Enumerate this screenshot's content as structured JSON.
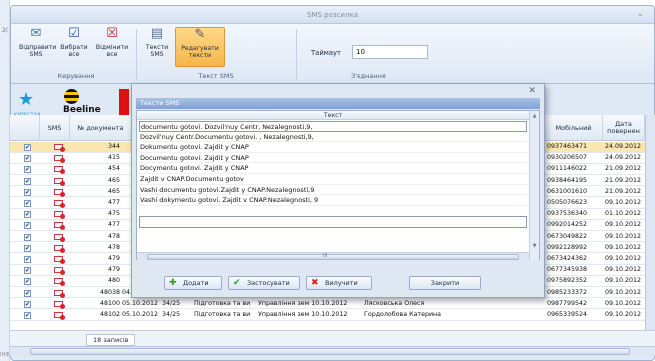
{
  "window": {
    "title": "SMS розсилка"
  },
  "ribbon": {
    "send_label": "Відправити SMS",
    "select_all_label": "Вибрати все",
    "deselect_all_label": "Відмінити все",
    "sms_texts_label": "Тексти SMS",
    "edit_texts_label": "Редагувати тексти",
    "timeout_label": "Таймаут",
    "timeout_value": "10",
    "group_control": "Керування",
    "group_text": "Текст SMS",
    "group_connection": "З'єднання"
  },
  "logos": {
    "kyivstar": "КИЇВСТАР",
    "beeline": "Beeline"
  },
  "grid": {
    "headers": {
      "sms": "SMS",
      "doc_no": "№ документа",
      "mobile": "Мобільний",
      "date": "Дата повернен"
    },
    "rows": [
      {
        "no": "344",
        "mobile": "0937463471",
        "date": "24.09.2012",
        "sel": true
      },
      {
        "no": "415",
        "mobile": "0930206507",
        "date": "24.09.2012"
      },
      {
        "no": "454",
        "mobile": "0911146022",
        "date": "21.09.2012"
      },
      {
        "no": "465",
        "mobile": "0938464195",
        "date": "21.09.2012"
      },
      {
        "no": "465",
        "mobile": "0631001610",
        "date": "21.09.2012"
      },
      {
        "no": "477",
        "mobile": "0505076623",
        "date": "09.10.2012"
      },
      {
        "no": "475",
        "mobile": "0937536340",
        "date": "01.10.2012"
      },
      {
        "no": "477",
        "mobile": "0992014252",
        "date": "09.10.2012"
      },
      {
        "no": "478",
        "mobile": "0673049822",
        "date": "09.10.2012"
      },
      {
        "no": "478",
        "mobile": "0992128992",
        "date": "09.10.2012"
      },
      {
        "no": "479",
        "mobile": "0673424362",
        "date": "09.10.2012"
      },
      {
        "no": "479",
        "mobile": "0677345938",
        "date": "09.10.2012"
      },
      {
        "no": "480",
        "mobile": "0975892352",
        "date": "09.10.2012"
      },
      {
        "no": "48038",
        "docdate": "04.10.2012",
        "num": "16/07",
        "desc": "Підготовка догов",
        "dept": "Фінансове упр. 11.10.2012",
        "person": "Равчак В.І, Равчак Ю.І.",
        "mobile": "0985233372",
        "date": "09.10.2012"
      },
      {
        "no": "48100",
        "docdate": "05.10.2012",
        "num": "34/25",
        "desc": "Підготовка та ви",
        "dept": "Управління зем 10.10.2012",
        "person": "Лясковська Олеся",
        "mobile": "0987799542",
        "date": "09.10.2012"
      },
      {
        "no": "48102",
        "docdate": "05.10.2012",
        "num": "34/25",
        "desc": "Підготовка та ви",
        "dept": "Управління зем 10.10.2012",
        "person": "Гордолобова Катерина",
        "mobile": "0965339524",
        "date": "09.10.2012"
      }
    ],
    "footer_count": "18 записів"
  },
  "dialog": {
    "title": "Тексти SMS",
    "column_header": "Текст",
    "items": [
      "documentu gotovi. Dozvil'nuy Centr, Nezalegnosti,9,",
      "Dozvil'nuy Centr.Documentu gotovi. , Nezalegnosti,9,",
      "Dokumentu gotovi. Zajdit y CNAP",
      "Documentu gotovi. Zajdit y CNAP",
      "Docymentu gotovi. Zajdit y CNAP",
      " Zajdit v CNAP.Documentu gotov",
      "Vashi documentu gotovi.Zajdit y CNAP.Nezalegnosti,9",
      "Vashi dokymentu gotovi. Zajdit v CNAP.Nezalegnosti, 9"
    ],
    "scroll_mid": "III",
    "add_label": "Додати",
    "apply_label": "Застосувати",
    "delete_label": "Вилучити",
    "close_label": "Закрити"
  }
}
